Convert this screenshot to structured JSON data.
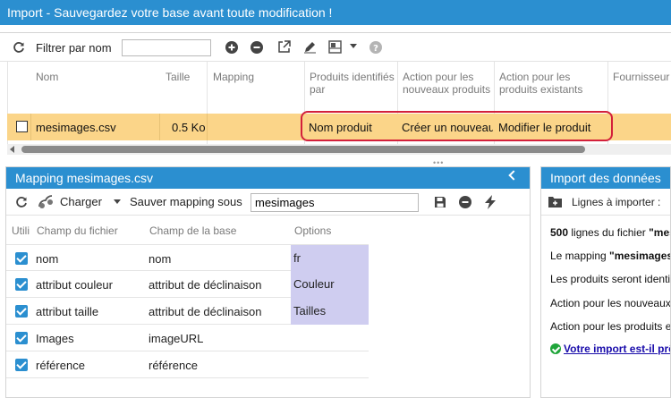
{
  "window": {
    "title": "Import - Sauvegardez votre base avant toute modification !"
  },
  "top_toolbar": {
    "filter_label": "Filtrer par nom",
    "filter_value": ""
  },
  "top_grid": {
    "columns": [
      "Nom",
      "Taille",
      "Mapping",
      "Produits identifiés par",
      "Action pour les nouveaux produits",
      "Action pour les produits existants",
      "Fournisseur"
    ],
    "rows": [
      {
        "nom": "mesimages.csv",
        "taille": "0.5 Ko",
        "mapping": "",
        "identifies_par": "Nom produit",
        "action_nouveaux": "Créer un nouveau",
        "action_existants": "Modifier le produit"
      }
    ]
  },
  "mapping_panel": {
    "title": "Mapping mesimages.csv",
    "load_label": "Charger",
    "save_label": "Sauver mapping sous",
    "mapping_name": "mesimages",
    "columns": [
      "Utili",
      "Champ du fichier",
      "Champ de la base",
      "Options"
    ],
    "rows": [
      {
        "file_field": "nom",
        "db_field": "nom",
        "option": "fr"
      },
      {
        "file_field": "attribut couleur",
        "db_field": "attribut de déclinaison",
        "option": "Couleur"
      },
      {
        "file_field": "attribut taille",
        "db_field": "attribut de déclinaison",
        "option": "Tailles"
      },
      {
        "file_field": "Images",
        "db_field": "imageURL",
        "option": ""
      },
      {
        "file_field": "référence",
        "db_field": "référence",
        "option": ""
      }
    ]
  },
  "import_panel": {
    "title": "Import des données",
    "rows_label": "Lignes à importer :",
    "line1_count": "500",
    "line1_text": " lignes du fichier ",
    "line1_file": "\"mes",
    "line2_text": "Le mapping ",
    "line2_name": "\"mesimages\"",
    "line3_text": "Les produits seront identif",
    "line4_text": "Action pour les nouveaux",
    "line5_text": "Action pour les produits ex",
    "ready_link": "Votre import est-il prê"
  },
  "colors": {
    "accent": "#2b8fd0",
    "selected_row": "#fbd589",
    "option_cell": "#cfcdf0",
    "highlight": "#d3203b",
    "ok": "#1fa53a"
  }
}
